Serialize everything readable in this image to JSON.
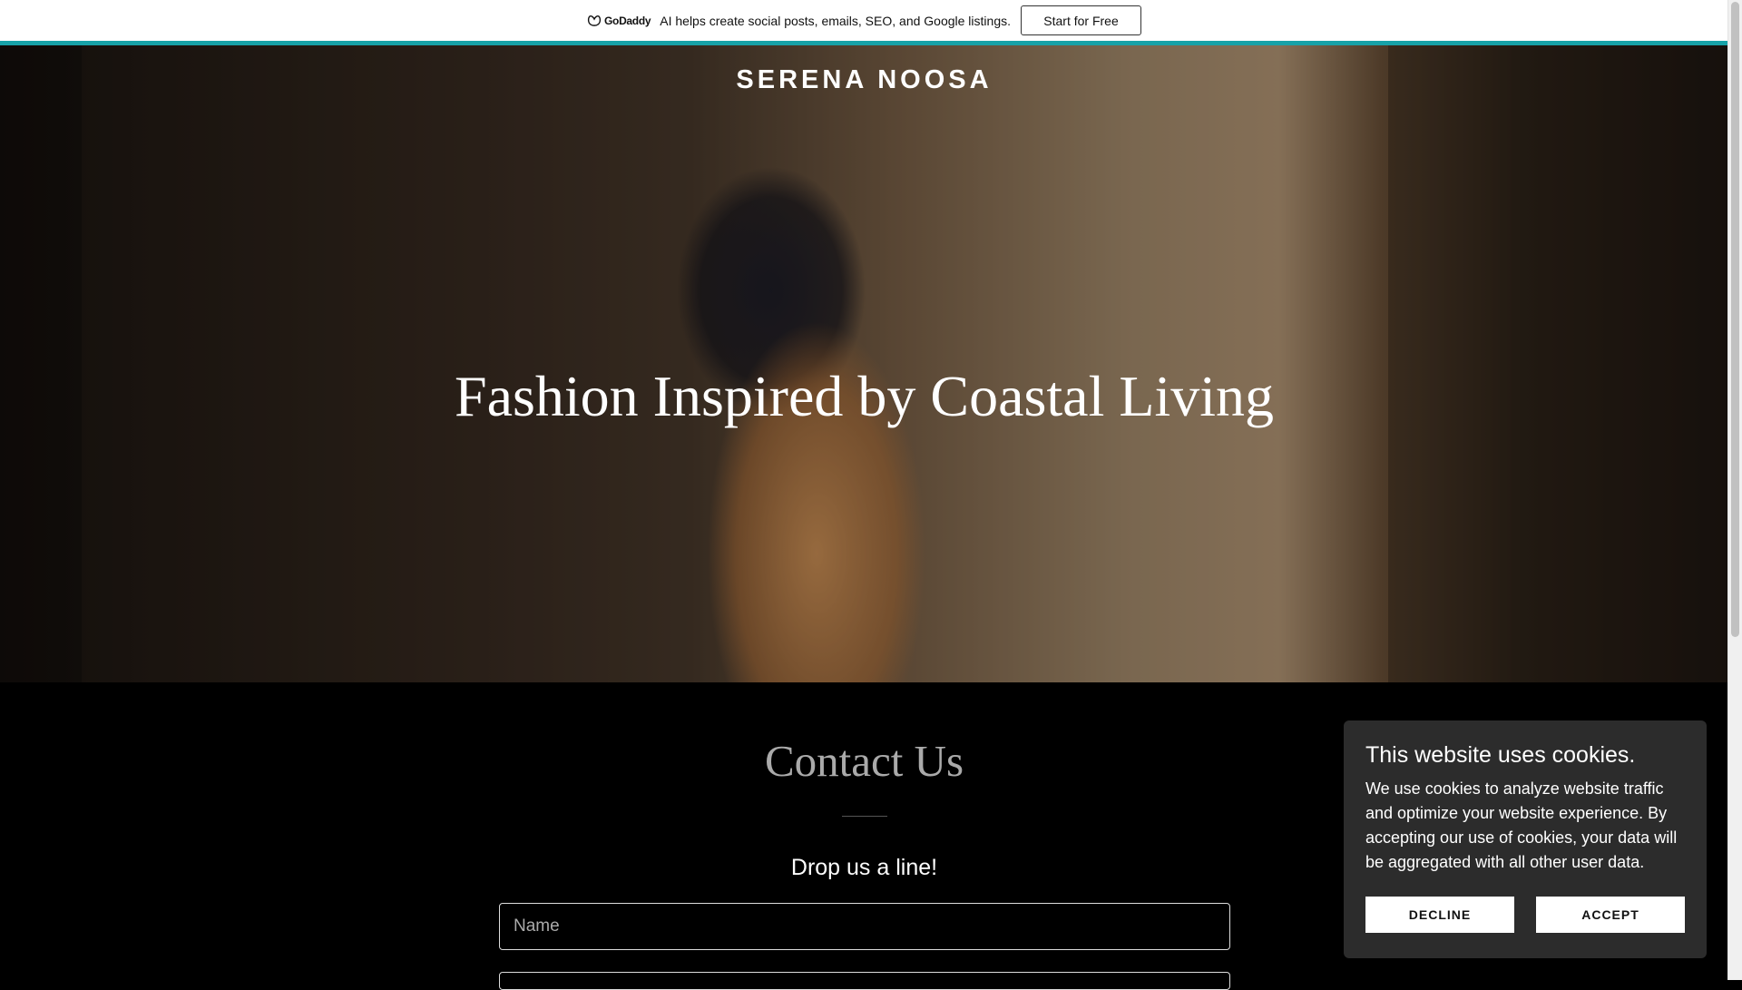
{
  "promo": {
    "logo_text": "GoDaddy",
    "message": "AI helps create social posts, emails, SEO, and Google listings.",
    "cta_label": "Start for Free",
    "accent_color": "#17a2a8"
  },
  "header": {
    "brand": "SERENA NOOSA"
  },
  "hero": {
    "title": "Fashion Inspired by Coastal Living"
  },
  "contact": {
    "title": "Contact Us",
    "subtitle": "Drop us a line!",
    "name_placeholder": "Name"
  },
  "cookie_banner": {
    "title": "This website uses cookies.",
    "body": "We use cookies to analyze website traffic and optimize your website experience. By accepting our use of cookies, your data will be aggregated with all other user data.",
    "decline_label": "DECLINE",
    "accept_label": "ACCEPT"
  },
  "icons": {
    "promo_logo": "godaddy-logo-icon"
  }
}
